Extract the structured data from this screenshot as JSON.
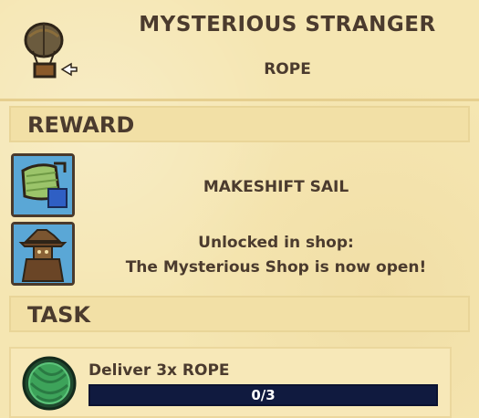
{
  "quest": {
    "title": "MYSTERIOUS STRANGER",
    "subtitle": "ROPE",
    "icon": "hot-air-balloon-icon"
  },
  "reward_section": {
    "label": "REWARD",
    "items": [
      {
        "icon": "makeshift-sail-icon",
        "text": "MAKESHIFT SAIL"
      },
      {
        "icon": "stranger-portrait-icon",
        "line1": "Unlocked in shop:",
        "line2": "The Mysterious Shop is now open!"
      }
    ]
  },
  "task_section": {
    "label": "TASK",
    "task": {
      "icon": "rope-coil-icon",
      "text": "Deliver 3x ROPE",
      "progress_text": "0/3",
      "progress_fraction": 0
    }
  }
}
